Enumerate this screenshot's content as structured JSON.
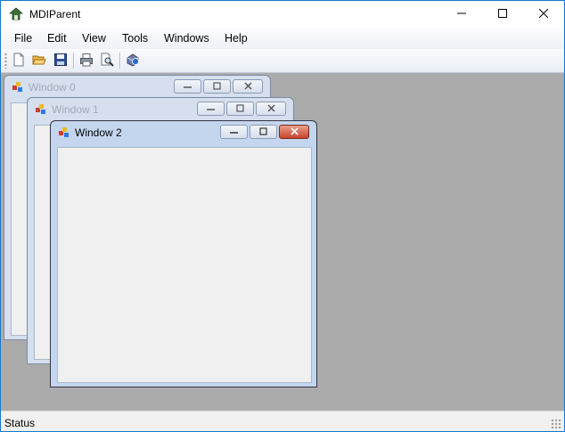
{
  "app": {
    "title": "MDIParent",
    "icon": "mdi-app-icon"
  },
  "caption_buttons": [
    "minimize-icon",
    "maximize-icon",
    "close-icon"
  ],
  "menu": {
    "items": [
      "File",
      "Edit",
      "View",
      "Tools",
      "Windows",
      "Help"
    ]
  },
  "toolbar": {
    "buttons": [
      "new-document-icon",
      "open-folder-icon",
      "save-icon",
      "print-icon",
      "print-preview-icon",
      "help-icon"
    ]
  },
  "children": [
    {
      "title": "Window 0",
      "active": false
    },
    {
      "title": "Window 1",
      "active": false
    },
    {
      "title": "Window 2",
      "active": true
    }
  ],
  "status": {
    "text": "Status"
  },
  "colors": {
    "mdi_background": "#ababab",
    "window_border": "#1979ca",
    "close_button": "#c8432b"
  }
}
